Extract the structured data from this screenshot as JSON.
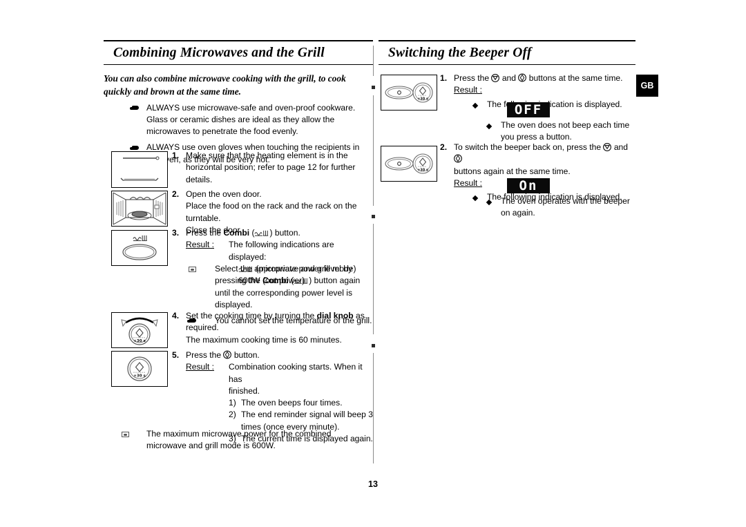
{
  "page": {
    "number": "13",
    "locale_tab": "GB"
  },
  "left": {
    "heading": "Combining Microwaves and the Grill",
    "intro": "You can also combine microwave cooking with the grill, to cook quickly and brown at the same time.",
    "warnings": [
      {
        "icon": "pointing-hand-icon",
        "text": "ALWAYS use microwave-safe and oven-proof cookware. Glass or ceramic dishes are ideal as they allow the microwaves to penetrate the food evenly."
      },
      {
        "icon": "pointing-hand-icon",
        "text": "ALWAYS use oven gloves when touching the recipients in the oven, as they will be very hot."
      }
    ],
    "steps": [
      {
        "num": "1.",
        "illustration": "heating-element-horizontal-illustration",
        "text": "Make sure that the heating element is in the horizontal position; refer to page 12 for further details."
      },
      {
        "num": "2.",
        "illustration": "open-oven-door-illustration",
        "line1": "Open the oven door.",
        "line2": "Place the food on the rack and the rack on the turntable.",
        "line3": "Close the door."
      },
      {
        "num": "3.",
        "illustration": "combi-button-illustration",
        "text_before": "Press the ",
        "text_bold": "Combi",
        "text_paren_open": " (",
        "text_paren_close": ") button.",
        "result_label": "Result :",
        "result_text": "The following indications are displayed:",
        "result_line_mode": "(microwave and grill mode)",
        "result_line_power": "600W (out power)"
      },
      {
        "num": "4.",
        "illustration": "dial-knob-turning-illustration",
        "line1_a": "Set the cooking time by turning the ",
        "line1_bold": "dial knob",
        "line1_b": " as required.",
        "line2": "The maximum cooking time is 60 minutes."
      },
      {
        "num": "5.",
        "illustration": "start-button-illustration",
        "text_before": "Press the ",
        "text_after": " button.",
        "result_label": "Result :",
        "result_text1": "Combination cooking starts. When it has",
        "result_text2": "finished.",
        "sublist": [
          {
            "n": "1)",
            "t": "The oven beeps four times."
          },
          {
            "n": "2)",
            "t": "The end reminder signal will beep 3 times (once every minute)."
          },
          {
            "n": "3)",
            "t": "The current time is displayed again."
          }
        ]
      }
    ],
    "power_note": {
      "icon": "note-square-icon",
      "text": "The maximum microwave power for the combined microwave and grill mode is 600W."
    },
    "inline_notes": [
      {
        "icon": "note-square-icon",
        "text_a": "Select the appropriate power level by pressing the ",
        "text_bold": "Combi",
        "text_paren_open": " (",
        "text_paren_close": ") button again until the corresponding power level is displayed."
      },
      {
        "icon": "pointing-hand-icon",
        "text": "You cannot set the temperature of the grill."
      }
    ]
  },
  "right": {
    "heading": "Switching the Beeper Off",
    "steps": [
      {
        "num": "1.",
        "illustration": "control-panel-stop-start-illustration",
        "text_before": "Press the ",
        "text_mid": " and ",
        "text_after": " buttons at the same time.",
        "result_label": "Result :",
        "bullets_top": [
          {
            "icon": "diamond-bullet-icon",
            "text": "The following indication is displayed."
          }
        ],
        "display": "OFF",
        "bullets_bottom": [
          {
            "icon": "diamond-bullet-icon",
            "text": "The oven does not beep each time you press a button."
          }
        ]
      },
      {
        "num": "2.",
        "illustration": "control-panel-stop-start-illustration",
        "text_before": "To switch the beeper back on, press the ",
        "text_mid": " and ",
        "text_after": "buttons again at the same time.",
        "result_label": "Result :",
        "bullets_top": [
          {
            "icon": "diamond-bullet-icon",
            "text": "The following indication is displayed."
          }
        ],
        "display": "On",
        "bullets_bottom": [
          {
            "icon": "diamond-bullet-icon",
            "text": "The oven operates with the beeper on again."
          }
        ]
      }
    ]
  },
  "colors": {
    "ink": "#000000",
    "lcd_background": "#0a0a0a",
    "lcd_text": "#ffffff",
    "rule": "#000000",
    "divider": "#8a8a8a"
  }
}
